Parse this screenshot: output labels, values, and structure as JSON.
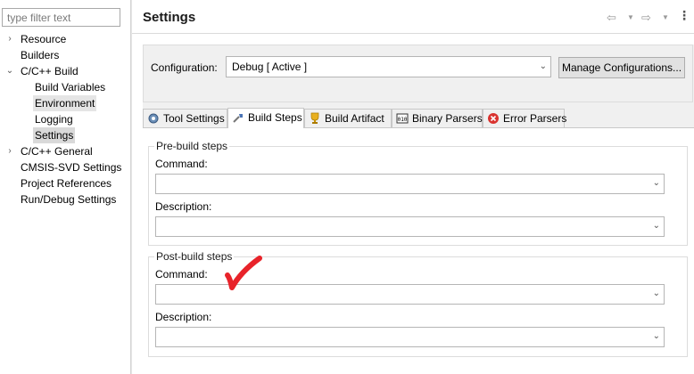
{
  "tree": {
    "filter_placeholder": "type filter text",
    "items": [
      {
        "label": "Resource",
        "level": 0,
        "twisty": "›"
      },
      {
        "label": "Builders",
        "level": 0,
        "twisty": ""
      },
      {
        "label": "C/C++ Build",
        "level": 0,
        "twisty": "⌄"
      },
      {
        "label": "Build Variables",
        "level": 1,
        "twisty": ""
      },
      {
        "label": "Environment",
        "level": 1,
        "twisty": ""
      },
      {
        "label": "Logging",
        "level": 1,
        "twisty": ""
      },
      {
        "label": "Settings",
        "level": 1,
        "twisty": ""
      },
      {
        "label": "C/C++ General",
        "level": 0,
        "twisty": "›"
      },
      {
        "label": "CMSIS-SVD Settings",
        "level": 0,
        "twisty": ""
      },
      {
        "label": "Project References",
        "level": 0,
        "twisty": ""
      },
      {
        "label": "Run/Debug Settings",
        "level": 0,
        "twisty": ""
      }
    ],
    "selected": "Settings"
  },
  "header": {
    "title": "Settings",
    "nav": {
      "back_icon": "arrow-left-icon",
      "forward_icon": "arrow-right-icon"
    }
  },
  "configuration": {
    "label": "Configuration:",
    "value": "Debug  [ Active ]",
    "manage_label": "Manage Configurations..."
  },
  "tabs": [
    {
      "label": "Tool Settings",
      "icon": "tool-settings-icon"
    },
    {
      "label": "Build Steps",
      "icon": "build-steps-icon",
      "active": true
    },
    {
      "label": "Build Artifact",
      "icon": "trophy-icon"
    },
    {
      "label": "Binary Parsers",
      "icon": "binary-icon"
    },
    {
      "label": "Error Parsers",
      "icon": "error-icon"
    }
  ],
  "pre_build": {
    "title": "Pre-build steps",
    "command_label": "Command:",
    "command_value": "",
    "description_label": "Description:",
    "description_value": ""
  },
  "post_build": {
    "title": "Post-build steps",
    "command_label": "Command:",
    "command_value": "",
    "description_label": "Description:",
    "description_value": ""
  },
  "annotation": {
    "checkmark_color": "#e8232a"
  }
}
